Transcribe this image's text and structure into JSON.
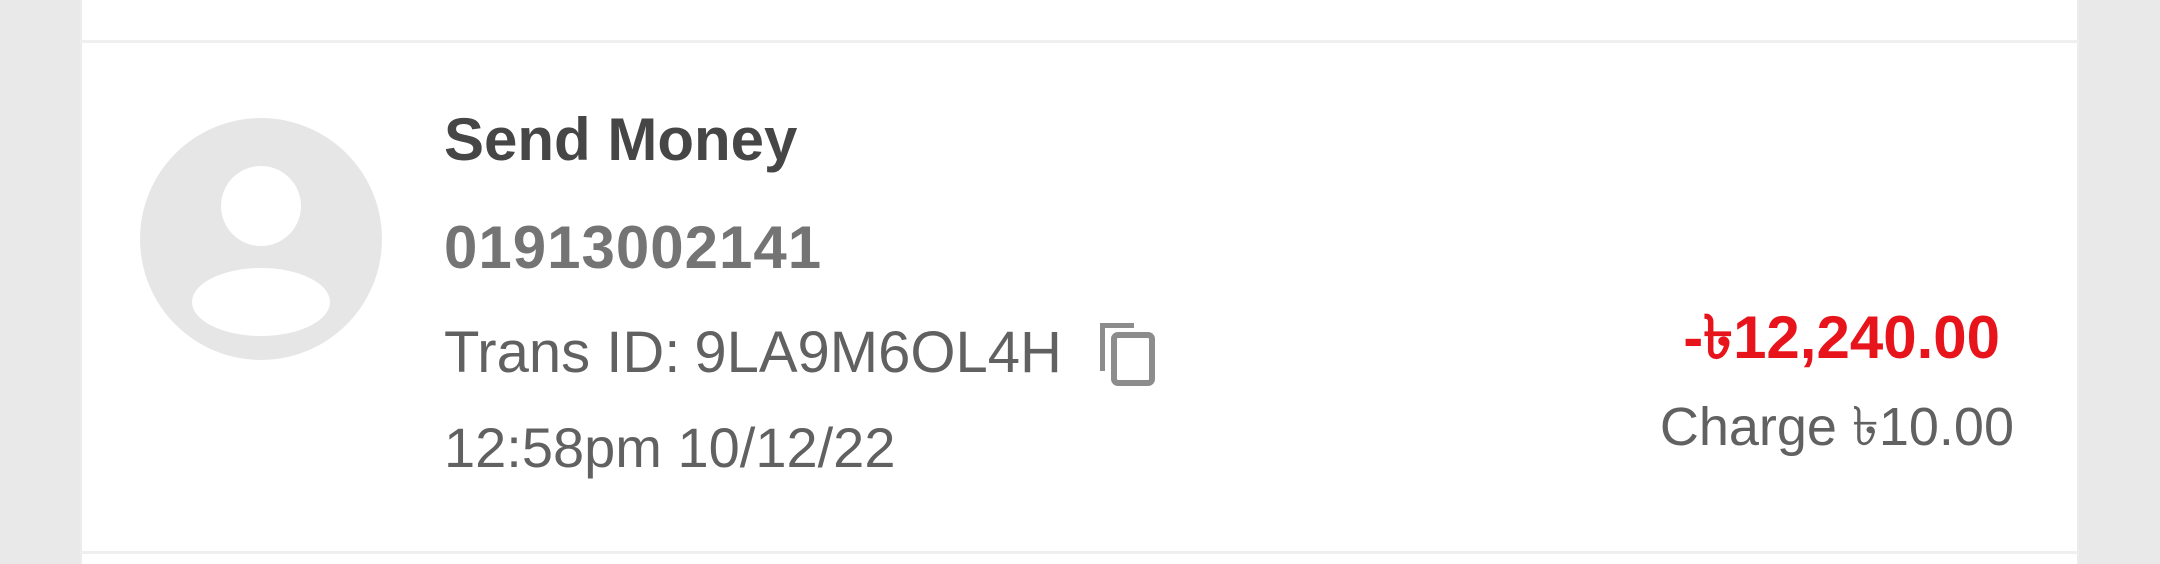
{
  "transaction": {
    "type_label": "Send Money",
    "phone_number": "01913002141",
    "trans_id_label": "Trans ID:",
    "trans_id": "9LA9M6OL4H",
    "timestamp": "12:58pm 10/12/22",
    "amount": "-৳12,240.00",
    "charge": "Charge ৳10.00",
    "avatar_icon": "user-avatar-icon",
    "copy_icon": "copy-icon"
  },
  "colors": {
    "amount_debit": "#e8141c",
    "title_text": "#464646",
    "secondary_text": "#616161",
    "avatar_bg": "#e6e6e6",
    "page_bg": "#e9e9e9",
    "card_bg": "#ffffff"
  }
}
